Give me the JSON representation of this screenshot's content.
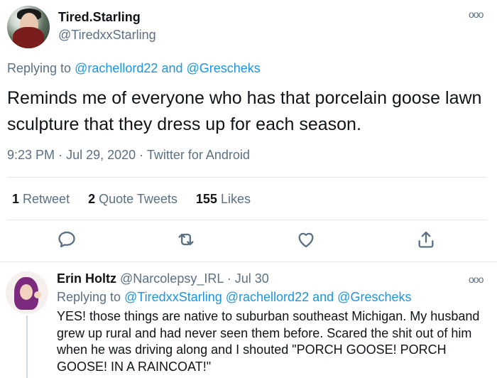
{
  "main_tweet": {
    "display_name": "Tired.Starling",
    "handle": "@TiredxxStarling",
    "more": "ooo",
    "replying_prefix": "Replying to",
    "replying_to": [
      "@rachellord22",
      "@Grescheks"
    ],
    "replying_and": "and",
    "text": "Reminds me of everyone who has that porcelain goose lawn sculpture that they dress up for each season.",
    "time": "9:23 PM",
    "date": "Jul 29, 2020",
    "source": "Twitter for Android",
    "dot": "·",
    "stats": [
      {
        "count": "1",
        "label": "Retweet"
      },
      {
        "count": "2",
        "label": "Quote Tweets"
      },
      {
        "count": "155",
        "label": "Likes"
      }
    ],
    "actions": [
      "reply-icon",
      "retweet-icon",
      "like-icon",
      "share-icon"
    ]
  },
  "reply_tweet": {
    "display_name": "Erin Holtz",
    "handle": "@Narcolepsy_IRL",
    "dot": "·",
    "date": "Jul 30",
    "more": "ooo",
    "replying_prefix": "Replying to",
    "replying_to": [
      "@TiredxxStarling",
      "@rachellord22",
      "@Grescheks"
    ],
    "replying_and": "and",
    "text": "YES! those things are native to suburban southeast Michigan. My husband grew up rural and had never seen them before. Scared the shit out of him when he was driving along and I shouted \"PORCH GOOSE! PORCH GOOSE! IN A RAINCOAT!\""
  },
  "colors": {
    "link": "#1b95e0",
    "secondary": "#5b7083",
    "text": "#0f1419",
    "divider": "#e1e8ed"
  }
}
